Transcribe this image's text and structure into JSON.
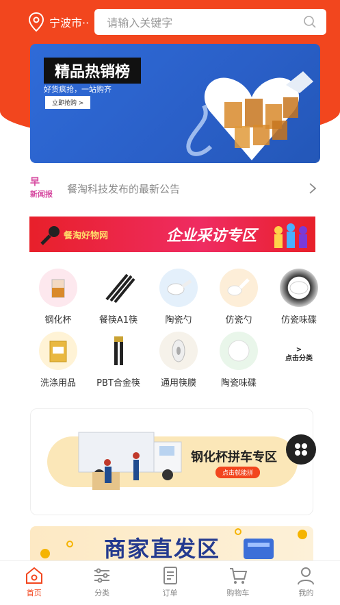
{
  "header": {
    "city": "宁波市··",
    "search_placeholder": "请输入关键字"
  },
  "banner": {
    "title": "精品热销榜",
    "subtitle": "好货疯抢，一站购齐",
    "button": "立即抢购 >"
  },
  "notice": {
    "logo_top": "早",
    "logo_bottom": "新闻报",
    "text": "餐淘科技发布的最新公告"
  },
  "interview": {
    "brand": "餐淘好物网",
    "title": "企业采访专区"
  },
  "categories": [
    {
      "label": "钢化杯"
    },
    {
      "label": "餐筷A1筷"
    },
    {
      "label": "陶瓷勺"
    },
    {
      "label": "仿瓷勺"
    },
    {
      "label": "仿瓷味碟"
    },
    {
      "label": "洗涤用品"
    },
    {
      "label": "PBT合金筷"
    },
    {
      "label": "通用筷膜"
    },
    {
      "label": "陶瓷味碟"
    },
    {
      "label": ">\n点击分类"
    }
  ],
  "promo": {
    "title": "钢化杯拼车专区",
    "button": "点击就能拼"
  },
  "merchant": {
    "title": "商家直发区"
  },
  "tabs": [
    {
      "label": "首页",
      "icon": "home-icon",
      "active": true
    },
    {
      "label": "分类",
      "icon": "sliders-icon",
      "active": false
    },
    {
      "label": "订单",
      "icon": "order-icon",
      "active": false
    },
    {
      "label": "购物车",
      "icon": "cart-icon",
      "active": false
    },
    {
      "label": "我的",
      "icon": "user-icon",
      "active": false
    }
  ],
  "colors": {
    "accent": "#f2461e",
    "banner_blue": "#2f6bd8",
    "merchant_text": "#243a8f"
  }
}
